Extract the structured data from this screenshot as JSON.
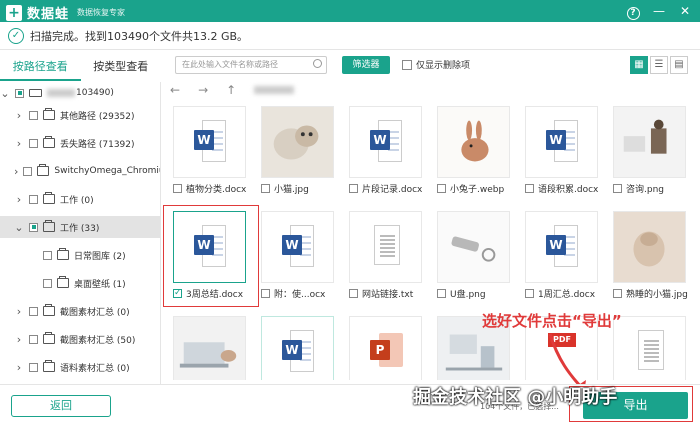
{
  "app": {
    "logo_mark": "+",
    "name": "数据蛙",
    "subtitle": "数据恢复专家",
    "help": "?",
    "minimize": "—",
    "close": "✕"
  },
  "status": {
    "text": "扫描完成。找到103490个文件共13.2 GB。"
  },
  "tabs": {
    "by_path": "按路径查看",
    "by_type": "按类型查看"
  },
  "toolbar": {
    "search_placeholder": "在此处输入文件名称或路径",
    "filter_label": "筛选器",
    "only_deleted_label": "仅显示删除项"
  },
  "nav": {
    "back": "←",
    "forward": "→",
    "up": "↑"
  },
  "tree": {
    "root_suffix": "103490)",
    "items": [
      {
        "label": "其他路径 (29352)",
        "level": 1,
        "expanded": false,
        "checked": "none",
        "selected": false
      },
      {
        "label": "丢失路径 (71392)",
        "level": 1,
        "expanded": false,
        "checked": "none",
        "selected": false
      },
      {
        "label": "SwitchyOmega_Chromiun",
        "level": 1,
        "expanded": false,
        "checked": "none",
        "selected": false
      },
      {
        "label": "工作 (0)",
        "level": 1,
        "expanded": false,
        "checked": "none",
        "selected": false
      },
      {
        "label": "工作 (33)",
        "level": 1,
        "expanded": true,
        "checked": "partial",
        "selected": true
      },
      {
        "label": "日常图库 (2)",
        "level": 2,
        "expanded": false,
        "checked": "none",
        "selected": false
      },
      {
        "label": "桌面壁纸 (1)",
        "level": 2,
        "expanded": false,
        "checked": "none",
        "selected": false
      },
      {
        "label": "截图素材汇总 (0)",
        "level": 1,
        "expanded": false,
        "checked": "none",
        "selected": false
      },
      {
        "label": "截图素材汇总 (50)",
        "level": 1,
        "expanded": false,
        "checked": "none",
        "selected": false
      },
      {
        "label": "语料素材汇总 (0)",
        "level": 1,
        "expanded": false,
        "checked": "none",
        "selected": false
      }
    ]
  },
  "files": [
    {
      "name": "植物分类.docx",
      "type": "word",
      "checked": false
    },
    {
      "name": "小猫.jpg",
      "type": "photo-cat",
      "checked": false
    },
    {
      "name": "片段记录.docx",
      "type": "word",
      "checked": false
    },
    {
      "name": "小兔子.webp",
      "type": "photo-rabbit",
      "checked": false
    },
    {
      "name": "语段积累.docx",
      "type": "word",
      "checked": false
    },
    {
      "name": "咨询.png",
      "type": "photo-office",
      "checked": false
    },
    {
      "name": "3周总结.docx",
      "type": "word",
      "checked": true
    },
    {
      "name": "附：使...ocx",
      "type": "word",
      "checked": false
    },
    {
      "name": "网站链接.txt",
      "type": "txt",
      "checked": false
    },
    {
      "name": "U盘.png",
      "type": "photo-usb",
      "checked": false
    },
    {
      "name": "1周汇总.docx",
      "type": "word",
      "checked": false
    },
    {
      "name": "熟睡的小猫.jpg",
      "type": "photo-kitten",
      "checked": false
    },
    {
      "name": "",
      "type": "photo-laptop",
      "checked": false
    },
    {
      "name": "",
      "type": "word",
      "checked": false
    },
    {
      "name": "",
      "type": "ppt",
      "checked": false
    },
    {
      "name": "",
      "type": "photo-desk",
      "checked": false
    },
    {
      "name": "",
      "type": "pdf",
      "checked": false
    },
    {
      "name": "",
      "type": "txt",
      "checked": false
    }
  ],
  "icons": {
    "word_badge": "W",
    "ppt_badge": "P",
    "pdf_badge": "PDF",
    "grid_view": "▦",
    "list_view": "☰",
    "detail_view": "▤"
  },
  "bottom": {
    "back_label": "返回",
    "info": "104个文件，已选择...",
    "export_label": "导出"
  },
  "annotation": {
    "text": "选好文件点击“导出”",
    "watermark": "掘金技术社区 @小明助手"
  },
  "colors": {
    "accent": "#1aa38c",
    "annotation": "#e03a3a",
    "word": "#2b579a",
    "ppt": "#c43e1c",
    "pdf": "#d9332a"
  }
}
